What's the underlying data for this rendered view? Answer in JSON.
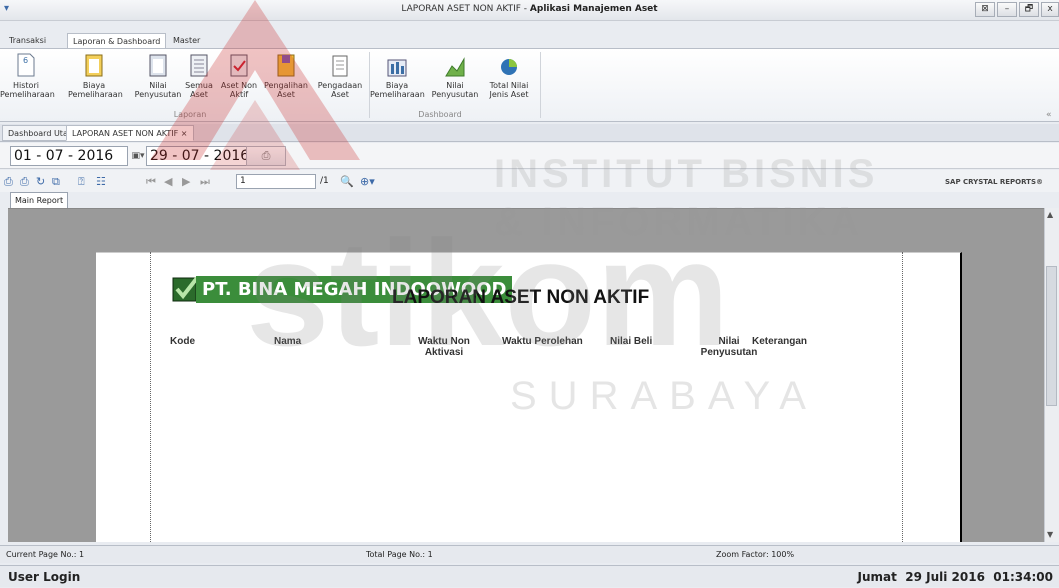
{
  "window": {
    "title_prefix": "LAPORAN ASET NON AKTIF - ",
    "title_app": "Aplikasi Manajemen Aset",
    "controls": [
      "⊠",
      "–",
      "🗗",
      "x"
    ]
  },
  "ribbon": {
    "tabs": [
      "Transaksi",
      "Laporan & Dashboard",
      "Master"
    ],
    "active_tab": "Laporan & Dashboard",
    "laporan": [
      {
        "l1": "Histori",
        "l2": "Pemeliharaan",
        "icon": "history-report-icon"
      },
      {
        "l1": "Biaya",
        "l2": "Pemeliharaan",
        "icon": "maintenance-cost-icon"
      },
      {
        "l1": "Nilai",
        "l2": "Penyusutan",
        "icon": "depreciation-report-icon"
      },
      {
        "l1": "Semua",
        "l2": "Aset",
        "icon": "all-assets-icon"
      },
      {
        "l1": "Aset Non",
        "l2": "Aktif",
        "icon": "inactive-asset-icon"
      },
      {
        "l1": "Pengalihan",
        "l2": "Aset",
        "icon": "asset-transfer-icon"
      },
      {
        "l1": "Pengadaan",
        "l2": "Aset",
        "icon": "asset-procurement-icon"
      }
    ],
    "laporan_label": "Laporan",
    "dashboard": [
      {
        "l1": "Biaya",
        "l2": "Pemeliharaan",
        "icon": "bar-chart-icon"
      },
      {
        "l1": "Nilai",
        "l2": "Penyusutan",
        "icon": "area-chart-icon"
      },
      {
        "l1": "Total Nilai",
        "l2": "Jenis Aset",
        "icon": "pie-chart-icon"
      }
    ],
    "dashboard_label": "Dashboard"
  },
  "doc_tabs": [
    "Dashboard Utama",
    "LAPORAN ASET NON AKTIF ×"
  ],
  "filter": {
    "date_from": "01 - 07 - 2016",
    "date_to": "29 - 07 - 2016"
  },
  "viewer": {
    "page_input": "1",
    "page_total": "/1",
    "brand": "SAP CRYSTAL REPORTS®",
    "main_report_tab": "Main Report"
  },
  "report": {
    "company": "PT. BINA MEGAH INDOOWOOD",
    "title": "LAPORAN ASET NON AKTIF",
    "columns": [
      {
        "l1": "Kode",
        "l2": ""
      },
      {
        "l1": "Nama",
        "l2": ""
      },
      {
        "l1": "Waktu Non",
        "l2": "Aktivasi"
      },
      {
        "l1": "Waktu Perolehan",
        "l2": ""
      },
      {
        "l1": "Nilai Beli",
        "l2": ""
      },
      {
        "l1": "Nilai",
        "l2": "Penyusutan"
      },
      {
        "l1": "Keterangan",
        "l2": ""
      }
    ]
  },
  "status": {
    "current_page": "Current Page No.: 1",
    "total_page": "Total Page No.: 1",
    "zoom": "Zoom Factor: 100%"
  },
  "footer": {
    "user": "User Login",
    "datetime": "Jumat  29 Juli 2016  01:34:00"
  },
  "watermark": {
    "line1": "INSTITUT BISNIS",
    "line2": "& INFORMATIKA",
    "big": "stikom",
    "city": "SURABAYA"
  }
}
